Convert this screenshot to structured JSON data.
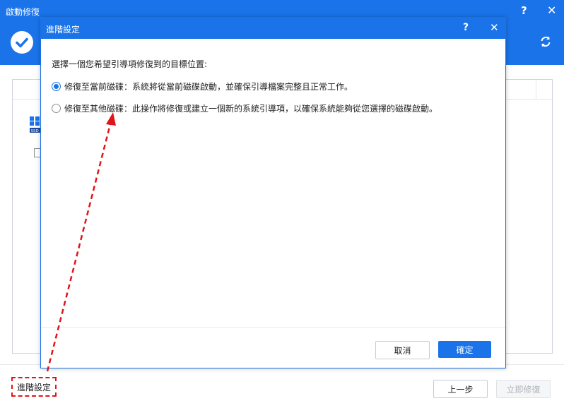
{
  "main": {
    "title": "啟動修復",
    "help_icon": "question-icon",
    "close_icon": "close-icon",
    "check_icon": "check-circle-icon",
    "refresh_icon": "refresh-icon",
    "disk_icon": "ssd-disk-icon",
    "advanced_label": "進階設定",
    "prev_label": "上一步",
    "repair_label": "立即修復"
  },
  "dialog": {
    "title": "進階設定",
    "prompt": "選擇一個您希望引導項修復到的目標位置:",
    "options": [
      {
        "label": "修復至當前磁碟：系統將從當前磁碟啟動，並確保引導檔案完整且正常工作。",
        "selected": true
      },
      {
        "label": "修復至其他磁碟：此操作將修復或建立一個新的系統引導項，以確保系統能夠從您選擇的磁碟啟動。",
        "selected": false
      }
    ],
    "cancel_label": "取消",
    "ok_label": "確定"
  },
  "colors": {
    "accent": "#1a73e8",
    "annotation": "#e0141b"
  }
}
